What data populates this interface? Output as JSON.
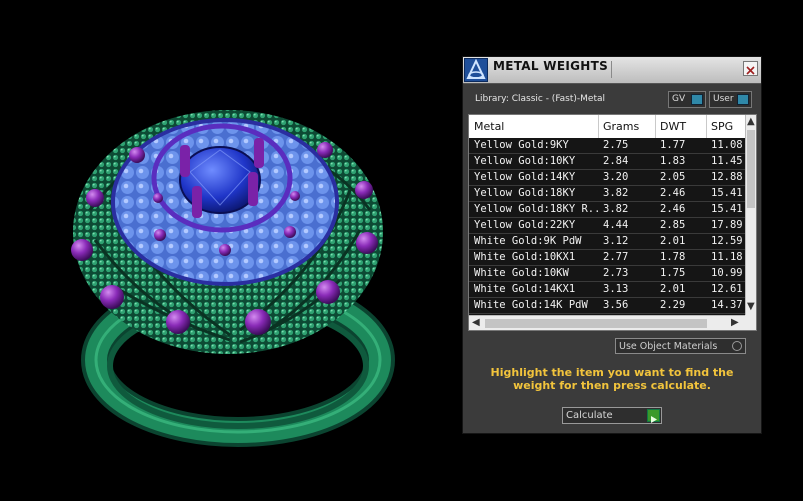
{
  "panel": {
    "title": "METAL WEIGHTS",
    "library_label": "Library: Classic - (Fast)-Metal",
    "toggles": [
      {
        "label": "GV"
      },
      {
        "label": "User"
      }
    ],
    "columns": [
      "Metal",
      "Grams",
      "DWT",
      "SPG"
    ],
    "rows": [
      [
        "Yellow Gold:9KY",
        "2.75",
        "1.77",
        "11.08"
      ],
      [
        "Yellow Gold:10KY",
        "2.84",
        "1.83",
        "11.45"
      ],
      [
        "Yellow Gold:14KY",
        "3.20",
        "2.05",
        "12.88"
      ],
      [
        "Yellow Gold:18KY",
        "3.82",
        "2.46",
        "15.41"
      ],
      [
        "Yellow Gold:18KY R...",
        "3.82",
        "2.46",
        "15.41"
      ],
      [
        "Yellow Gold:22KY",
        "4.44",
        "2.85",
        "17.89"
      ],
      [
        "White Gold:9K PdW",
        "3.12",
        "2.01",
        "12.59"
      ],
      [
        "White Gold:10KX1",
        "2.77",
        "1.78",
        "11.18"
      ],
      [
        "White Gold:10KW",
        "2.73",
        "1.75",
        "10.99"
      ],
      [
        "White Gold:14KX1",
        "3.13",
        "2.01",
        "12.61"
      ],
      [
        "White Gold:14K PdW",
        "3.56",
        "2.29",
        "14.37"
      ]
    ],
    "use_object_materials": "Use Object Materials",
    "hint": "Highlight the item you want to find the weight for then press calculate.",
    "calculate_label": "Calculate"
  },
  "icons": {
    "app": "app-logo-icon",
    "close": "close-icon",
    "scroll_up": "chevron-up-icon",
    "scroll_down": "chevron-down-icon",
    "scroll_left": "chevron-left-icon",
    "scroll_right": "chevron-right-icon",
    "calc": "play-arrow-icon"
  }
}
